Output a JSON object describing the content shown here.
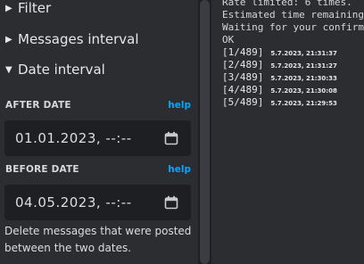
{
  "sections": {
    "filter": {
      "label": "Filter",
      "expanded": false
    },
    "messages_interval": {
      "label": "Messages interval",
      "expanded": false
    },
    "date_interval": {
      "label": "Date interval",
      "expanded": true
    }
  },
  "after_date": {
    "label": "AFTER DATE",
    "help": "help",
    "value": "01.01.2023, --:--",
    "icon": "calendar-icon"
  },
  "before_date": {
    "label": "BEFORE DATE",
    "help": "help",
    "value": "04.05.2023, --:--",
    "icon": "calendar-icon"
  },
  "description": "Delete messages that were posted between the two dates.",
  "log": {
    "lines": [
      "Rate limited: 6 times.",
      "Estimated time remaining",
      "Waiting for your confirm",
      "OK"
    ],
    "entries": [
      {
        "index": "[1/489]",
        "timestamp": "5.7.2023, 21:31:37"
      },
      {
        "index": "[2/489]",
        "timestamp": "5.7.2023, 21:31:27"
      },
      {
        "index": "[3/489]",
        "timestamp": "5.7.2023, 21:30:33"
      },
      {
        "index": "[4/489]",
        "timestamp": "5.7.2023, 21:30:08"
      },
      {
        "index": "[5/489]",
        "timestamp": "5.7.2023, 21:29:53"
      }
    ]
  },
  "colors": {
    "background": "#2b2d31",
    "input_background": "#1e1f22",
    "link": "#00a8fc"
  }
}
